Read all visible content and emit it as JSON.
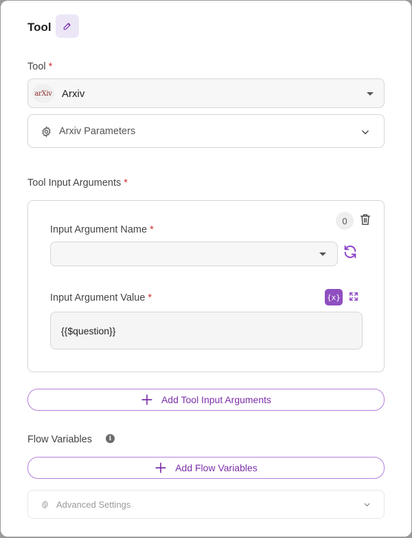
{
  "header": {
    "title": "Tool"
  },
  "tool_field": {
    "label": "Tool",
    "required_mark": "*",
    "selected_value": "Arxiv",
    "logo_text": "arXiv"
  },
  "parameters_accordion": {
    "label": "Arxiv Parameters"
  },
  "tool_input_arguments": {
    "label": "Tool Input Arguments",
    "required_mark": "*",
    "items": [
      {
        "index_badge": "0",
        "name_label": "Input Argument Name",
        "name_value": "",
        "value_label": "Input Argument Value",
        "value": "{{$question}}",
        "variable_button": "{x}"
      }
    ],
    "add_button": "Add Tool Input Arguments"
  },
  "flow_variables": {
    "label": "Flow Variables",
    "add_button": "Add Flow Variables"
  },
  "advanced_settings": {
    "label": "Advanced Settings"
  },
  "colors": {
    "accent": "#7b2ea8",
    "accent_border": "#b57edc",
    "required": "#d32f2f",
    "variable_button": "#8f4fc0"
  }
}
